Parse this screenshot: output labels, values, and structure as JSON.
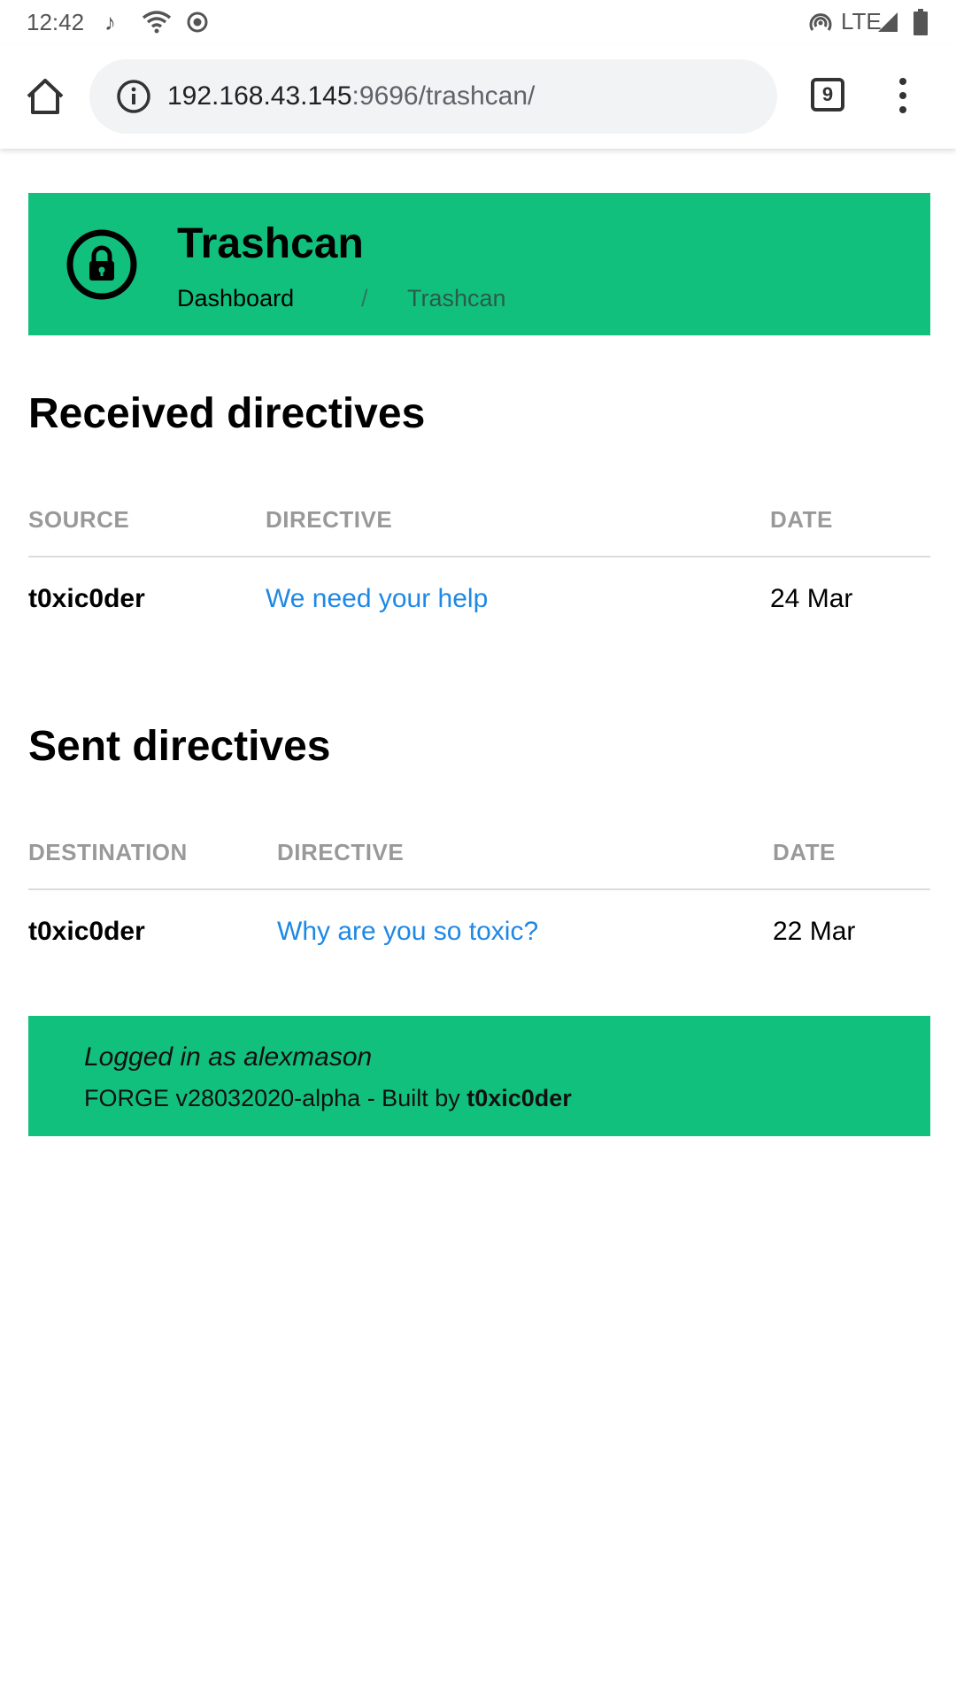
{
  "status_bar": {
    "time": "12:42",
    "network": "LTE"
  },
  "browser": {
    "url_host": "192.168.43.145",
    "url_rest": ":9696/trashcan/",
    "tab_count": "9"
  },
  "header": {
    "title": "Trashcan",
    "breadcrumb": {
      "home": "Dashboard",
      "separator": "/",
      "current": "Trashcan"
    }
  },
  "received": {
    "heading": "Received directives",
    "columns": [
      "SOURCE",
      "DIRECTIVE",
      "DATE"
    ],
    "rows": [
      {
        "user": "t0xic0der",
        "directive": "We need your help",
        "date": "24 Mar"
      }
    ]
  },
  "sent": {
    "heading": "Sent directives",
    "columns": [
      "DESTINATION",
      "DIRECTIVE",
      "DATE"
    ],
    "rows": [
      {
        "user": "t0xic0der",
        "directive": "Why are you so toxic?",
        "date": "22 Mar"
      }
    ]
  },
  "footer": {
    "login_text": "Logged in as alexmason",
    "build_text": "FORGE v28032020-alpha - Built by ",
    "build_author": "t0xic0der"
  },
  "colors": {
    "accent": "#12c07e",
    "link": "#1e88e5",
    "muted": "#999999"
  }
}
